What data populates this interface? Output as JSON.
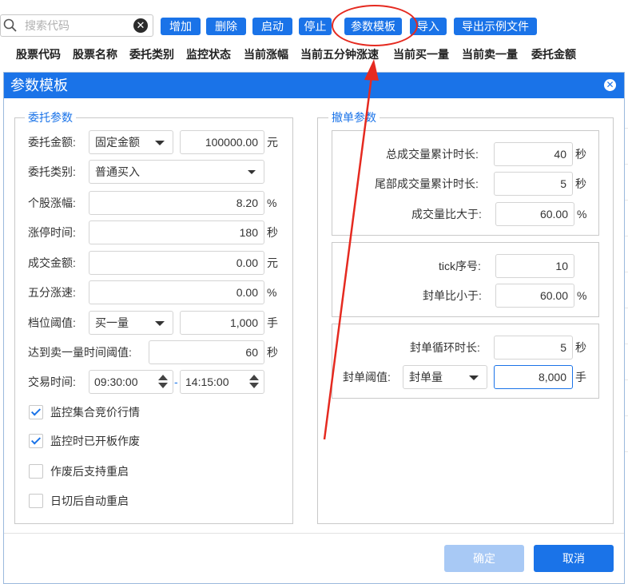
{
  "toolbar": {
    "search_placeholder": "搜索代码",
    "clear_glyph": "✕",
    "buttons": [
      "增加",
      "删除",
      "启动",
      "停止",
      "参数模板",
      "导入",
      "导出示例文件"
    ]
  },
  "table_headers": [
    "股票代码",
    "股票名称",
    "委托类别",
    "监控状态",
    "当前涨幅",
    "当前五分钟涨速",
    "当前买一量",
    "当前卖一量",
    "委托金额"
  ],
  "annotation": {
    "highlight_target": "参数模板",
    "color": "#e52a20"
  },
  "dialog": {
    "title": "参数模板",
    "close_glyph": "✕",
    "left": {
      "legend": "委托参数",
      "order_amount": {
        "label": "委托金额:",
        "mode": "固定金额",
        "value": "100000.00",
        "unit": "元"
      },
      "order_type": {
        "label": "委托类别:",
        "value": "普通买入"
      },
      "stock_rise": {
        "label": "个股涨幅:",
        "value": "8.20",
        "unit": "%"
      },
      "limit_time": {
        "label": "涨停时间:",
        "value": "180",
        "unit": "秒"
      },
      "turnover": {
        "label": "成交金额:",
        "value": "0.00",
        "unit": "元"
      },
      "five_min_speed": {
        "label": "五分涨速:",
        "value": "0.00",
        "unit": "%"
      },
      "level_threshold": {
        "label": "档位阈值:",
        "mode": "买一量",
        "value": "1,000",
        "unit": "手"
      },
      "ask1_time_threshold": {
        "label": "达到卖一量时间阈值:",
        "value": "60",
        "unit": "秒"
      },
      "trade_time": {
        "label": "交易时间:",
        "start": "09:30:00",
        "separator": "-",
        "end": "14:15:00"
      },
      "checkboxes": [
        {
          "label": "监控集合竞价行情",
          "checked": true
        },
        {
          "label": "监控时已开板作废",
          "checked": true
        },
        {
          "label": "作废后支持重启",
          "checked": false
        },
        {
          "label": "日切后自动重启",
          "checked": false
        }
      ]
    },
    "right": {
      "legend": "撤单参数",
      "total_volume_time": {
        "label": "总成交量累计时长:",
        "value": "40",
        "unit": "秒"
      },
      "tail_volume_time": {
        "label": "尾部成交量累计时长:",
        "value": "5",
        "unit": "秒"
      },
      "volume_ratio": {
        "label": "成交量比大于:",
        "value": "60.00",
        "unit": "%"
      },
      "tick_index": {
        "label": "tick序号:",
        "value": "10"
      },
      "seal_ratio": {
        "label": "封单比小于:",
        "value": "60.00",
        "unit": "%"
      },
      "seal_loop_time": {
        "label": "封单循环时长:",
        "value": "5",
        "unit": "秒"
      },
      "seal_threshold": {
        "label": "封单阈值:",
        "mode": "封单量",
        "value": "8,000",
        "unit": "手"
      }
    },
    "confirm_label": "确定",
    "cancel_label": "取消"
  }
}
